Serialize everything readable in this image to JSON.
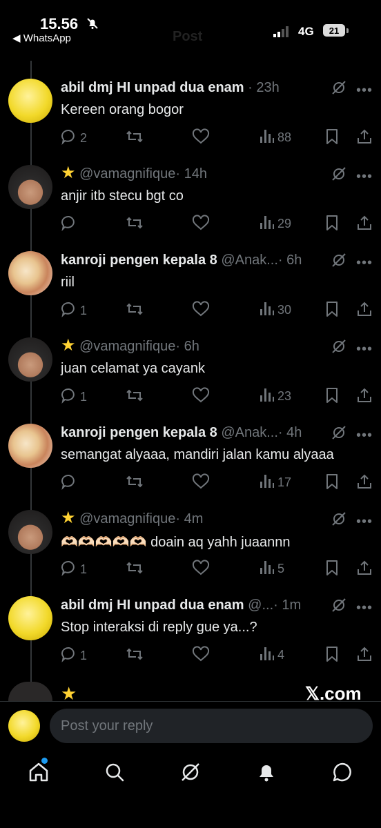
{
  "status": {
    "time": "15.56",
    "back_app": "◀ WhatsApp",
    "network": "4G",
    "battery": "21"
  },
  "header": {
    "ghost_title": "Post"
  },
  "tweets": [
    {
      "name": "abil dmj HI unpad dua enam",
      "handle": "",
      "time": "· 23h",
      "star": false,
      "text": "Kereen orang bogor",
      "replies": "2",
      "views": "88",
      "avatar": "yellow"
    },
    {
      "name": "",
      "handle": "@vamagnifique",
      "time": "· 14h",
      "star": true,
      "text": "anjir itb stecu bgt co",
      "replies": "",
      "views": "29",
      "avatar": "boy"
    },
    {
      "name": "kanroji pengen kepala 8",
      "handle": "@Anak...",
      "time": "· 6h",
      "star": false,
      "text": "riil",
      "replies": "1",
      "views": "30",
      "avatar": "anime"
    },
    {
      "name": "",
      "handle": "@vamagnifique",
      "time": "· 6h",
      "star": true,
      "text": "juan celamat ya cayank",
      "replies": "1",
      "views": "23",
      "avatar": "boy"
    },
    {
      "name": "kanroji pengen kepala 8",
      "handle": "@Anak...",
      "time": "· 4h",
      "star": false,
      "text": "semangat alyaaa, mandiri jalan kamu alyaaa",
      "replies": "",
      "views": "17",
      "avatar": "anime"
    },
    {
      "name": "",
      "handle": "@vamagnifique",
      "time": "· 4m",
      "star": true,
      "text": "🫶🏻🫶🏻🫶🏻🫶🏻🫶🏻 doain aq yahh juaannn",
      "replies": "1",
      "views": "5",
      "avatar": "boy"
    },
    {
      "name": "abil dmj HI unpad dua enam",
      "handle": "@...",
      "time": "· 1m",
      "star": false,
      "text": "Stop interaksi di reply gue ya...?",
      "replies": "1",
      "views": "4",
      "avatar": "yellow"
    }
  ],
  "peek": {
    "star": "★",
    "watermark": "𝕏.com"
  },
  "reply": {
    "placeholder": "Post your reply"
  },
  "tabs": [
    "home-icon",
    "search-icon",
    "grok-icon",
    "notifications-icon",
    "messages-icon"
  ],
  "colors": {
    "background": "#000000",
    "text": "#e7e9ea",
    "muted": "#71767b",
    "accent": "#1d9bf0",
    "star": "#ffd233"
  }
}
